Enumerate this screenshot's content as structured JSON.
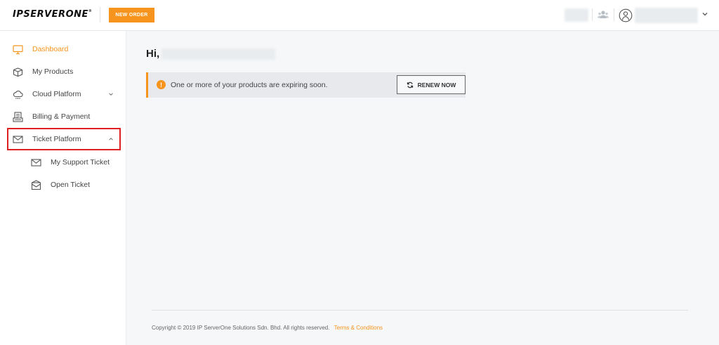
{
  "header": {
    "logo_text": "IPSERVERONE",
    "logo_mark": "®",
    "new_order_label": "NEW ORDER"
  },
  "sidebar": {
    "items": [
      {
        "label": "Dashboard",
        "icon": "monitor-icon",
        "active": true
      },
      {
        "label": "My Products",
        "icon": "box-icon"
      },
      {
        "label": "Cloud Platform",
        "icon": "cloud-icon",
        "chevron": "down"
      },
      {
        "label": "Billing & Payment",
        "icon": "invoice-icon"
      },
      {
        "label": "Ticket Platform",
        "icon": "envelope-icon",
        "chevron": "up",
        "highlighted": true
      }
    ],
    "subitems": [
      {
        "label": "My Support Ticket",
        "icon": "envelope-icon"
      },
      {
        "label": "Open Ticket",
        "icon": "envelope-open-icon"
      }
    ]
  },
  "main": {
    "greeting": "Hi,",
    "alert": {
      "icon_text": "!",
      "text": "One or more of your products are expiring soon.",
      "button_label": "RENEW NOW"
    },
    "footer": {
      "copyright": "Copyright © 2019 IP ServerOne Solutions Sdn. Bhd. All rights reserved.",
      "terms_label": "Terms & Conditions"
    }
  },
  "colors": {
    "accent": "#f7941d",
    "highlight_border": "#e02020",
    "main_bg": "#f5f7f8",
    "alert_bg": "#e7e9ec"
  }
}
